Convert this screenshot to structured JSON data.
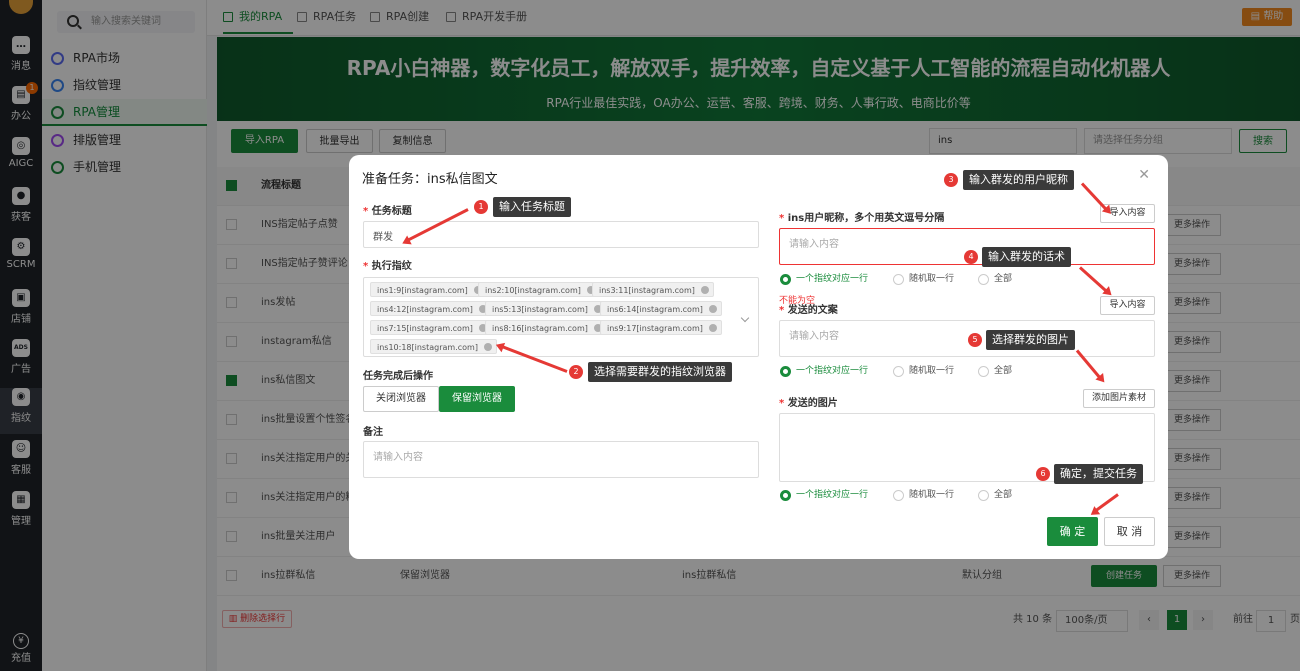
{
  "sidebar": {
    "badge": "1",
    "items": [
      {
        "icon": "message-icon",
        "glyph": "…",
        "label": "消息"
      },
      {
        "icon": "office-icon",
        "glyph": "▤",
        "label": "办公"
      },
      {
        "icon": "aigc-icon",
        "glyph": "◎",
        "label": "AIGC"
      },
      {
        "icon": "customer-icon",
        "glyph": "●",
        "label": "获客"
      },
      {
        "icon": "scrm-icon",
        "glyph": "⚙",
        "label": "SCRM"
      },
      {
        "icon": "store-icon",
        "glyph": "▣",
        "label": "店铺"
      },
      {
        "icon": "ads-icon",
        "glyph": "ADS",
        "label": "广告"
      },
      {
        "icon": "fingerprint-icon",
        "glyph": "◉",
        "label": "指纹"
      },
      {
        "icon": "service-icon",
        "glyph": "☺",
        "label": "客服"
      },
      {
        "icon": "manage-icon",
        "glyph": "▦",
        "label": "管理"
      }
    ],
    "recharge": {
      "glyph": "¥",
      "label": "充值"
    }
  },
  "menu": {
    "search_placeholder": "输入搜索关键词",
    "items": [
      "RPA市场",
      "指纹管理",
      "RPA管理",
      "排版管理",
      "手机管理"
    ]
  },
  "tabs": [
    "我的RPA",
    "RPA任务",
    "RPA创建",
    "RPA开发手册"
  ],
  "help_label": "帮助",
  "banner": {
    "title": "RPA小白神器，数字化员工，解放双手，提升效率，自定义基于人工智能的流程自动化机器人",
    "subtitle": "RPA行业最佳实践，OA办公、运营、客服、跨境、财务、人事行政、电商比价等"
  },
  "toolbar": {
    "import": "导入RPA",
    "export": "批量导出",
    "copy": "复制信息",
    "search_value": "ins",
    "group_placeholder": "请选择任务分组",
    "search": "搜索"
  },
  "table": {
    "header_title": "流程标题",
    "rows": [
      {
        "title": "INS指定帖子点赞",
        "checked": false
      },
      {
        "title": "INS指定帖子赞评论",
        "checked": false
      },
      {
        "title": "ins发帖",
        "checked": false
      },
      {
        "title": "instagram私信",
        "checked": false
      },
      {
        "title": "ins私信图文",
        "checked": true
      },
      {
        "title": "ins批量设置个性签名",
        "checked": false
      },
      {
        "title": "ins关注指定用户的关注",
        "checked": false
      },
      {
        "title": "ins关注指定用户的粉丝",
        "checked": false
      },
      {
        "title": "ins批量关注用户",
        "checked": false
      },
      {
        "title": "ins拉群私信",
        "checked": false,
        "after_action": "保留浏览器",
        "name": "ins拉群私信",
        "group": "默认分组"
      }
    ],
    "create_task": "创建任务",
    "more": "更多操作",
    "delete_selected": "删除选择行"
  },
  "pager": {
    "total": "共 10 条",
    "per_page": "100条/页",
    "current": "1",
    "goto": "前往",
    "goto_value": "1",
    "page_unit": "页"
  },
  "modal": {
    "title": "准备任务：ins私信图文",
    "task_title_label": "任务标题",
    "task_title_value": "群发",
    "fingerprint_label": "执行指纹",
    "fingerprints": [
      "ins1:9[instagram.com]",
      "ins2:10[instagram.com]",
      "ins3:11[instagram.com]",
      "ins4:12[instagram.com]",
      "ins5:13[instagram.com]",
      "ins6:14[instagram.com]",
      "ins7:15[instagram.com]",
      "ins8:16[instagram.com]",
      "ins9:17[instagram.com]",
      "ins10:18[instagram.com]"
    ],
    "after_label": "任务完成后操作",
    "close_browser": "关闭浏览器",
    "keep_browser": "保留浏览器",
    "remark_label": "备注",
    "placeholder": "请输入内容",
    "nickname_label": "ins用户昵称，多个用英文逗号分隔",
    "import_content": "导入内容",
    "radio_one": "一个指纹对应一行",
    "radio_random": "随机取一行",
    "radio_all": "全部",
    "error_text": "不能为空",
    "copy_label": "发送的文案",
    "image_label": "发送的图片",
    "add_image": "添加图片素材",
    "confirm": "确 定",
    "cancel": "取 消"
  },
  "annotations": [
    {
      "num": "1",
      "text": "输入任务标题"
    },
    {
      "num": "2",
      "text": "选择需要群发的指纹浏览器"
    },
    {
      "num": "3",
      "text": "输入群发的用户昵称"
    },
    {
      "num": "4",
      "text": "输入群发的话术"
    },
    {
      "num": "5",
      "text": "选择群发的图片"
    },
    {
      "num": "6",
      "text": "确定，提交任务"
    }
  ]
}
